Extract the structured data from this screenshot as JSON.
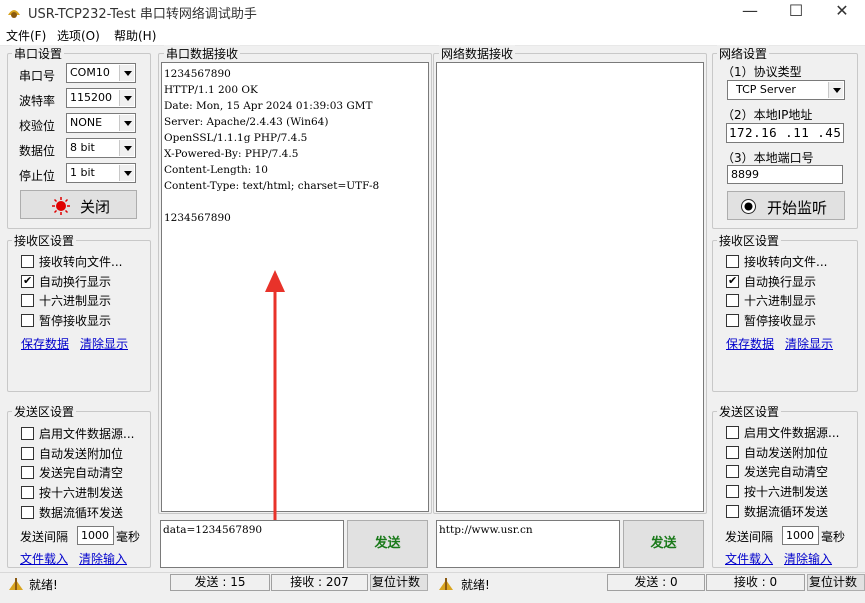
{
  "window": {
    "title": "USR-TCP232-Test 串口转网络调试助手",
    "minimize": "—",
    "maximize": "☐",
    "close": "✕"
  },
  "menu": [
    "文件(F)",
    "选项(O)",
    "帮助(H)"
  ],
  "serial": {
    "group_label": "串口设置",
    "port_label": "串口号",
    "port_value": "COM10",
    "baud_label": "波特率",
    "baud_value": "115200",
    "parity_label": "校验位",
    "parity_value": "NONE",
    "data_label": "数据位",
    "data_value": "8 bit",
    "stop_label": "停止位",
    "stop_value": "1 bit",
    "close_button": "关闭"
  },
  "left_recv": {
    "group_label": "接收区设置",
    "options": [
      {
        "label": "接收转向文件...",
        "checked": false
      },
      {
        "label": "自动换行显示",
        "checked": true
      },
      {
        "label": "十六进制显示",
        "checked": false
      },
      {
        "label": "暂停接收显示",
        "checked": false
      }
    ],
    "save_link": "保存数据",
    "clear_link": "清除显示"
  },
  "left_send": {
    "group_label": "发送区设置",
    "options": [
      {
        "label": "启用文件数据源...",
        "checked": false
      },
      {
        "label": "自动发送附加位",
        "checked": false
      },
      {
        "label": "发送完自动清空",
        "checked": false
      },
      {
        "label": "按十六进制发送",
        "checked": false
      },
      {
        "label": "数据流循环发送",
        "checked": false
      }
    ],
    "interval_label": "发送间隔",
    "interval_value": "1000",
    "interval_unit": "毫秒",
    "load_link": "文件载入",
    "clear_link": "清除输入"
  },
  "serial_receive": {
    "label": "串口数据接收",
    "lines": [
      "1234567890",
      "HTTP/1.1 200 OK",
      "Date: Mon, 15 Apr 2024 01:39:03 GMT",
      "Server: Apache/2.4.43 (Win64)",
      "OpenSSL/1.1.1g PHP/7.4.5",
      "X-Powered-By: PHP/7.4.5",
      "Content-Length: 10",
      "Content-Type: text/html; charset=UTF-8",
      "",
      "1234567890"
    ]
  },
  "net_receive": {
    "label": "网络数据接收"
  },
  "serial_send": {
    "text": "data=1234567890",
    "button": "发送"
  },
  "net_send": {
    "text": "http://www.usr.cn",
    "button": "发送"
  },
  "network": {
    "group_label": "网络设置",
    "protocol_label": "（1）协议类型",
    "protocol_value": "TCP Server",
    "ip_label": "（2）本地IP地址",
    "ip_value": "172.16 .11 .45",
    "port_label": "（3）本地端口号",
    "port_value": "8899",
    "listen_button": "开始监听"
  },
  "right_recv": {
    "group_label": "接收区设置",
    "options": [
      {
        "label": "接收转向文件...",
        "checked": false
      },
      {
        "label": "自动换行显示",
        "checked": true
      },
      {
        "label": "十六进制显示",
        "checked": false
      },
      {
        "label": "暂停接收显示",
        "checked": false
      }
    ],
    "save_link": "保存数据",
    "clear_link": "清除显示"
  },
  "right_send": {
    "group_label": "发送区设置",
    "options": [
      {
        "label": "启用文件数据源...",
        "checked": false
      },
      {
        "label": "自动发送附加位",
        "checked": false
      },
      {
        "label": "发送完自动清空",
        "checked": false
      },
      {
        "label": "按十六进制发送",
        "checked": false
      },
      {
        "label": "数据流循环发送",
        "checked": false
      }
    ],
    "interval_label": "发送间隔",
    "interval_value": "1000",
    "interval_unit": "毫秒",
    "load_link": "文件载入",
    "clear_link": "清除输入"
  },
  "status": {
    "left_ready": "就绪!",
    "left_sent": "发送 : 15",
    "left_recv": "接收 : 207",
    "left_reset": "复位计数",
    "right_ready": "就绪!",
    "right_sent": "发送 : 0",
    "right_recv": "接收 : 0",
    "right_reset": "复位计数"
  },
  "colors": {
    "arrow": "#e8322a",
    "send_text": "#1a7a1a",
    "link": "#0000cc",
    "record_dot": "#e00000"
  }
}
